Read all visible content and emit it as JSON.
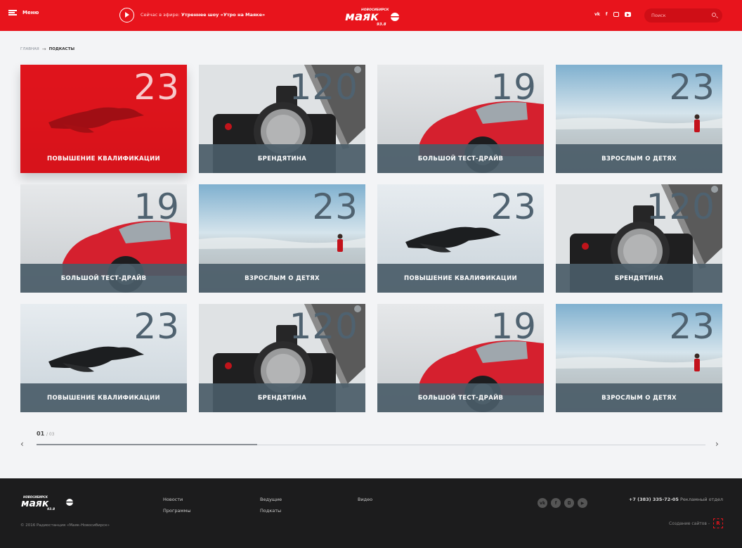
{
  "header": {
    "menu_label": "Меню",
    "onair_prefix": "Сейчас в эфире:",
    "onair_show": "Утреннее шоу «Утро на Маяке»",
    "logo_text": "маяк",
    "logo_city": "НОВОСИБИРСК",
    "logo_freq": "93.8",
    "social": [
      "vk",
      "f",
      "instagram",
      "youtube"
    ],
    "search_placeholder": "Поиск"
  },
  "breadcrumb": {
    "home": "ГЛАВНАЯ",
    "current": "ПОДКАСТЫ"
  },
  "cards": [
    {
      "title": "ПОВЫШЕНИЕ КВАЛИФИКАЦИИ",
      "count": "23",
      "theme": "crow",
      "active": true
    },
    {
      "title": "БРЕНДЯТИНА",
      "count": "120",
      "theme": "camera"
    },
    {
      "title": "БОЛЬШОЙ ТЕСТ-ДРАЙВ",
      "count": "19",
      "theme": "car"
    },
    {
      "title": "ВЗРОСЛЫМ О ДЕТЯХ",
      "count": "23",
      "theme": "sea"
    },
    {
      "title": "БОЛЬШОЙ ТЕСТ-ДРАЙВ",
      "count": "19",
      "theme": "car"
    },
    {
      "title": "ВЗРОСЛЫМ О ДЕТЯХ",
      "count": "23",
      "theme": "sea"
    },
    {
      "title": "ПОВЫШЕНИЕ КВАЛИФИКАЦИИ",
      "count": "23",
      "theme": "crow"
    },
    {
      "title": "БРЕНДЯТИНА",
      "count": "120",
      "theme": "camera"
    },
    {
      "title": "ПОВЫШЕНИЕ КВАЛИФИКАЦИИ",
      "count": "23",
      "theme": "crow"
    },
    {
      "title": "БРЕНДЯТИНА",
      "count": "120",
      "theme": "camera"
    },
    {
      "title": "БОЛЬШОЙ ТЕСТ-ДРАЙВ",
      "count": "19",
      "theme": "car"
    },
    {
      "title": "ВЗРОСЛЫМ О ДЕТЯХ",
      "count": "23",
      "theme": "sea"
    }
  ],
  "pager": {
    "current": "01",
    "total": "/ 03",
    "progress": 0.33
  },
  "footer": {
    "links_col1": [
      "Новости",
      "Программы"
    ],
    "links_col2": [
      "Ведущие",
      "Подкаты"
    ],
    "links_col3": [
      "Видео"
    ],
    "phone": "+7 (383) 335-72-05",
    "phone_label": "Рекламный отдел",
    "made_by": "Создание сайтов -",
    "copyright": "© 2016 Радиостанция «Маяк-Новосибирск»"
  },
  "colors": {
    "brand": "#e8141c",
    "bar": "#4a5c68",
    "footer": "#1c1c1d"
  }
}
